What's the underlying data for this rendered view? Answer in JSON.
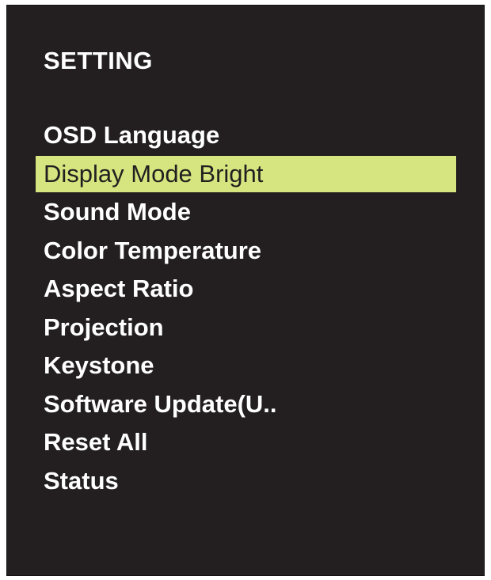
{
  "menu": {
    "title": "SETTING",
    "accent_color": "#d6e57f",
    "background_color": "#231f20",
    "selected_index": 1,
    "items": [
      {
        "label": "OSD Language"
      },
      {
        "label": "Display Mode Bright"
      },
      {
        "label": "Sound Mode"
      },
      {
        "label": "Color Temperature"
      },
      {
        "label": "Aspect Ratio"
      },
      {
        "label": "Projection"
      },
      {
        "label": "Keystone"
      },
      {
        "label": "Software Update(U.."
      },
      {
        "label": "Reset All"
      },
      {
        "label": "Status"
      }
    ]
  }
}
